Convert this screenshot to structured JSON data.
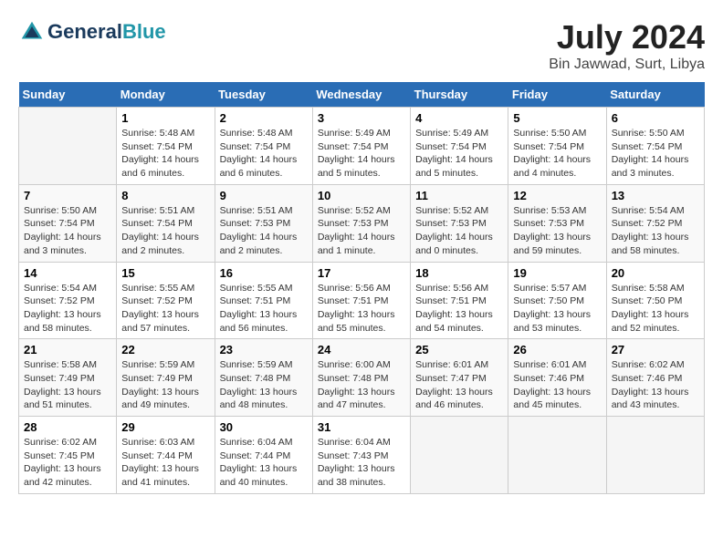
{
  "header": {
    "logo_line1": "General",
    "logo_line2": "Blue",
    "title": "July 2024",
    "subtitle": "Bin Jawwad, Surt, Libya"
  },
  "calendar": {
    "days_of_week": [
      "Sunday",
      "Monday",
      "Tuesday",
      "Wednesday",
      "Thursday",
      "Friday",
      "Saturday"
    ],
    "weeks": [
      [
        {
          "day": "",
          "info": ""
        },
        {
          "day": "1",
          "info": "Sunrise: 5:48 AM\nSunset: 7:54 PM\nDaylight: 14 hours\nand 6 minutes."
        },
        {
          "day": "2",
          "info": "Sunrise: 5:48 AM\nSunset: 7:54 PM\nDaylight: 14 hours\nand 6 minutes."
        },
        {
          "day": "3",
          "info": "Sunrise: 5:49 AM\nSunset: 7:54 PM\nDaylight: 14 hours\nand 5 minutes."
        },
        {
          "day": "4",
          "info": "Sunrise: 5:49 AM\nSunset: 7:54 PM\nDaylight: 14 hours\nand 5 minutes."
        },
        {
          "day": "5",
          "info": "Sunrise: 5:50 AM\nSunset: 7:54 PM\nDaylight: 14 hours\nand 4 minutes."
        },
        {
          "day": "6",
          "info": "Sunrise: 5:50 AM\nSunset: 7:54 PM\nDaylight: 14 hours\nand 3 minutes."
        }
      ],
      [
        {
          "day": "7",
          "info": "Sunrise: 5:50 AM\nSunset: 7:54 PM\nDaylight: 14 hours\nand 3 minutes."
        },
        {
          "day": "8",
          "info": "Sunrise: 5:51 AM\nSunset: 7:54 PM\nDaylight: 14 hours\nand 2 minutes."
        },
        {
          "day": "9",
          "info": "Sunrise: 5:51 AM\nSunset: 7:53 PM\nDaylight: 14 hours\nand 2 minutes."
        },
        {
          "day": "10",
          "info": "Sunrise: 5:52 AM\nSunset: 7:53 PM\nDaylight: 14 hours\nand 1 minute."
        },
        {
          "day": "11",
          "info": "Sunrise: 5:52 AM\nSunset: 7:53 PM\nDaylight: 14 hours\nand 0 minutes."
        },
        {
          "day": "12",
          "info": "Sunrise: 5:53 AM\nSunset: 7:53 PM\nDaylight: 13 hours\nand 59 minutes."
        },
        {
          "day": "13",
          "info": "Sunrise: 5:54 AM\nSunset: 7:52 PM\nDaylight: 13 hours\nand 58 minutes."
        }
      ],
      [
        {
          "day": "14",
          "info": "Sunrise: 5:54 AM\nSunset: 7:52 PM\nDaylight: 13 hours\nand 58 minutes."
        },
        {
          "day": "15",
          "info": "Sunrise: 5:55 AM\nSunset: 7:52 PM\nDaylight: 13 hours\nand 57 minutes."
        },
        {
          "day": "16",
          "info": "Sunrise: 5:55 AM\nSunset: 7:51 PM\nDaylight: 13 hours\nand 56 minutes."
        },
        {
          "day": "17",
          "info": "Sunrise: 5:56 AM\nSunset: 7:51 PM\nDaylight: 13 hours\nand 55 minutes."
        },
        {
          "day": "18",
          "info": "Sunrise: 5:56 AM\nSunset: 7:51 PM\nDaylight: 13 hours\nand 54 minutes."
        },
        {
          "day": "19",
          "info": "Sunrise: 5:57 AM\nSunset: 7:50 PM\nDaylight: 13 hours\nand 53 minutes."
        },
        {
          "day": "20",
          "info": "Sunrise: 5:58 AM\nSunset: 7:50 PM\nDaylight: 13 hours\nand 52 minutes."
        }
      ],
      [
        {
          "day": "21",
          "info": "Sunrise: 5:58 AM\nSunset: 7:49 PM\nDaylight: 13 hours\nand 51 minutes."
        },
        {
          "day": "22",
          "info": "Sunrise: 5:59 AM\nSunset: 7:49 PM\nDaylight: 13 hours\nand 49 minutes."
        },
        {
          "day": "23",
          "info": "Sunrise: 5:59 AM\nSunset: 7:48 PM\nDaylight: 13 hours\nand 48 minutes."
        },
        {
          "day": "24",
          "info": "Sunrise: 6:00 AM\nSunset: 7:48 PM\nDaylight: 13 hours\nand 47 minutes."
        },
        {
          "day": "25",
          "info": "Sunrise: 6:01 AM\nSunset: 7:47 PM\nDaylight: 13 hours\nand 46 minutes."
        },
        {
          "day": "26",
          "info": "Sunrise: 6:01 AM\nSunset: 7:46 PM\nDaylight: 13 hours\nand 45 minutes."
        },
        {
          "day": "27",
          "info": "Sunrise: 6:02 AM\nSunset: 7:46 PM\nDaylight: 13 hours\nand 43 minutes."
        }
      ],
      [
        {
          "day": "28",
          "info": "Sunrise: 6:02 AM\nSunset: 7:45 PM\nDaylight: 13 hours\nand 42 minutes."
        },
        {
          "day": "29",
          "info": "Sunrise: 6:03 AM\nSunset: 7:44 PM\nDaylight: 13 hours\nand 41 minutes."
        },
        {
          "day": "30",
          "info": "Sunrise: 6:04 AM\nSunset: 7:44 PM\nDaylight: 13 hours\nand 40 minutes."
        },
        {
          "day": "31",
          "info": "Sunrise: 6:04 AM\nSunset: 7:43 PM\nDaylight: 13 hours\nand 38 minutes."
        },
        {
          "day": "",
          "info": ""
        },
        {
          "day": "",
          "info": ""
        },
        {
          "day": "",
          "info": ""
        }
      ]
    ]
  }
}
